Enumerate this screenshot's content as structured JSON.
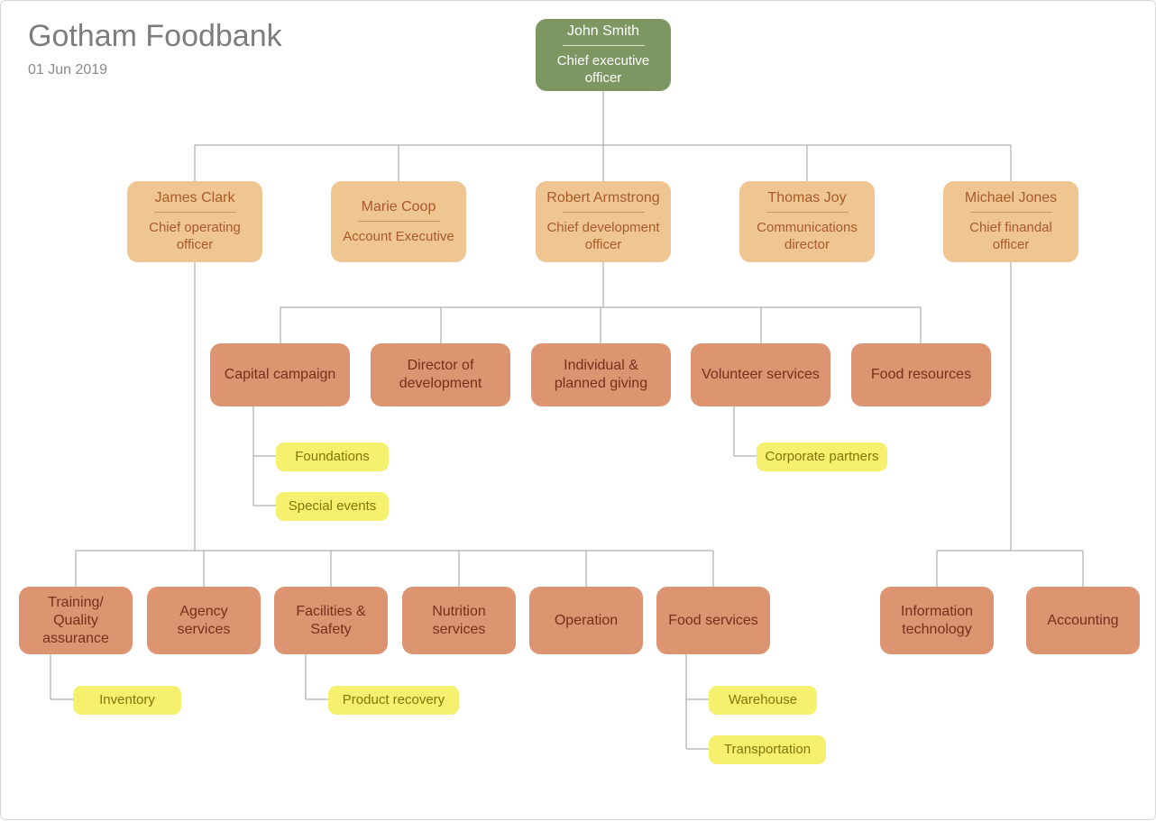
{
  "title": "Gotham Foodbank",
  "date": "01 Jun 2019",
  "root": {
    "name": "John Smith",
    "role": "Chief executive officer"
  },
  "level2": [
    {
      "name": "James Clark",
      "role": "Chief operating officer"
    },
    {
      "name": "Marie Coop",
      "role": "Account Executive"
    },
    {
      "name": "Robert Armstrong",
      "role": "Chief development officer"
    },
    {
      "name": "Thomas Joy",
      "role": "Communications director"
    },
    {
      "name": "Michael Jones",
      "role": "Chief finandal officer"
    }
  ],
  "dev_children": [
    "Capital campaign",
    "Director of development",
    "Individual & planned giving",
    "Volunteer services",
    "Food resources"
  ],
  "capital_leaf": [
    "Foundations",
    "Special events"
  ],
  "volunteer_leaf": [
    "Corporate partners"
  ],
  "ops_children": [
    "Training/ Quality assurance",
    "Agency services",
    "Facilities & Safety",
    "Nutrition services",
    "Operation",
    "Food services"
  ],
  "training_leaf": [
    "Inventory"
  ],
  "facilities_leaf": [
    "Product recovery"
  ],
  "foodsvc_leaf": [
    "Warehouse",
    "Transportation"
  ],
  "fin_children": [
    "Information technology",
    "Accounting"
  ]
}
